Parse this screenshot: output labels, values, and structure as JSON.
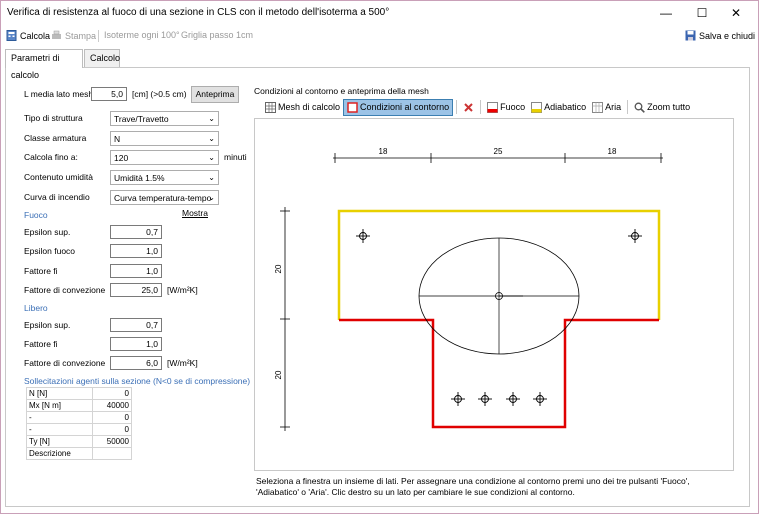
{
  "window": {
    "title": "Verifica di resistenza al fuoco di una sezione in CLS con il metodo dell'isoterma a 500°",
    "minimize": "—",
    "maximize": "☐",
    "close": "✕"
  },
  "toolbar": {
    "calcola": "Calcola",
    "stampa": "Stampa",
    "isoterme": "Isoterme ogni 100°",
    "griglia": "Griglia passo 1cm",
    "salva": "Salva e chiudi"
  },
  "tabs": [
    "Parametri di calcolo",
    "Calcolo"
  ],
  "form": {
    "mesh_label": "L media lato mesh",
    "mesh_value": "5,0",
    "mesh_unit": "[cm] (>0.5 cm)",
    "anteprima": "Anteprima",
    "tipo_label": "Tipo di struttura",
    "tipo_value": "Trave/Travetto",
    "classe_label": "Classe armatura",
    "classe_value": "N",
    "calcola_label": "Calcola fino a:",
    "calcola_value": "120",
    "calcola_unit": "minuti",
    "umidita_label": "Contenuto umidità",
    "umidita_value": "Umidità 1.5%",
    "curva_label": "Curva di incendio",
    "curva_value": "Curva temperatura-tempo",
    "fuoco_title": "Fuoco",
    "mostra": "Mostra",
    "eps_sup_label": "Epsilon sup.",
    "eps_sup_fuoco": "0,7",
    "eps_fuoco_label": "Epsilon fuoco",
    "eps_fuoco_value": "1,0",
    "fi_label": "Fattore fi",
    "fi_fuoco": "1,0",
    "conv_label": "Fattore di convezione",
    "conv_fuoco": "25,0",
    "conv_unit": "[W/m²K]",
    "libero_title": "Libero",
    "eps_sup_libero": "0,7",
    "fi_libero": "1,0",
    "conv_libero": "6,0",
    "soll_title": "Sollecitazioni agenti sulla sezione (N<0 se di compressione)"
  },
  "loads": [
    {
      "name": "N [N]",
      "value": "0"
    },
    {
      "name": "Mx [N m]",
      "value": "40000"
    },
    {
      "name": "-",
      "value": "0"
    },
    {
      "name": "-",
      "value": "0"
    },
    {
      "name": "Ty [N]",
      "value": "50000"
    },
    {
      "name": "Descrizione",
      "value": ""
    }
  ],
  "right": {
    "title": "Condizioni al contorno e anteprima della mesh",
    "mesh": "Mesh di calcolo",
    "cond": "Condizioni al contorno",
    "fuoco": "Fuoco",
    "adiabatico": "Adiabatico",
    "aria": "Aria",
    "zoom": "Zoom tutto"
  },
  "drawing": {
    "dim_top": [
      "18",
      "25",
      "18"
    ],
    "dim_left": [
      "20",
      "20"
    ],
    "fire_color": "#e00000",
    "adiabatic_color": "#e8d000"
  },
  "footer": "Seleziona a finestra un insieme di lati. Per assegnare una condizione al contorno premi uno dei tre pulsanti 'Fuoco', 'Adiabatico' o 'Aria'. Clic destro su un lato per cambiare le sue condizioni al contorno."
}
